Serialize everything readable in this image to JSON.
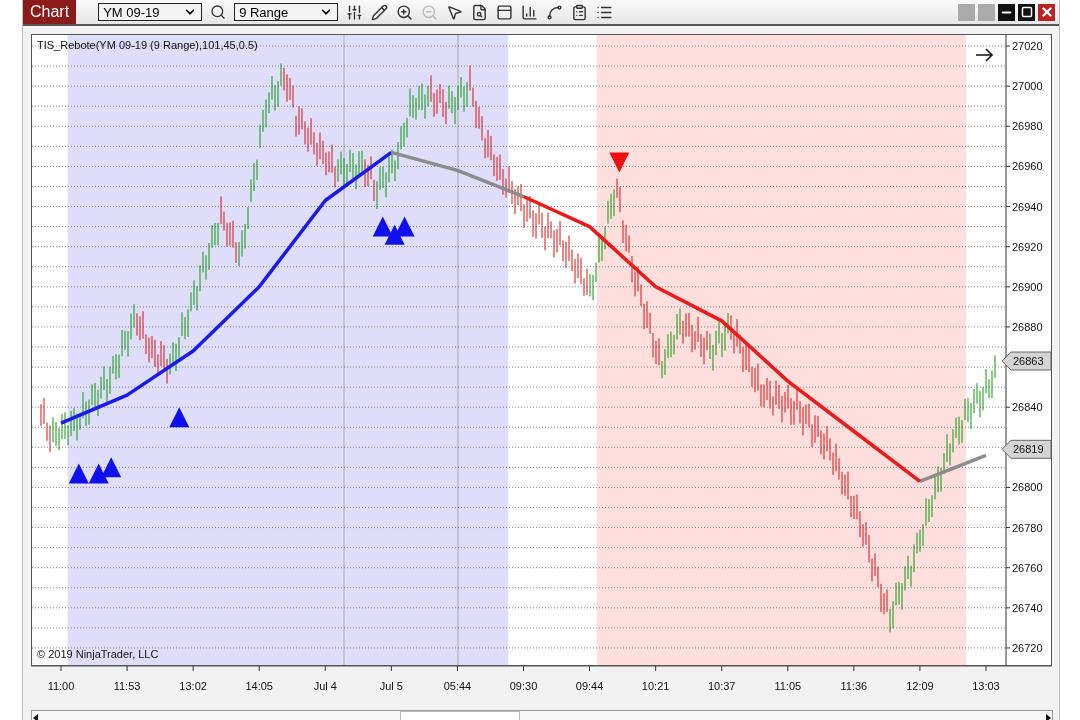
{
  "window": {
    "tab": "Chart",
    "instrument": "YM 09-19",
    "interval": "9 Range"
  },
  "chart": {
    "label": "TIS_Rebote(YM 09-19 (9 Range),101,45,0.5)",
    "copyright": "© 2019 NinjaTrader, LLC",
    "chart_data": {
      "type": "line",
      "categories": [
        "11:00",
        "11:53",
        "13:02",
        "14:05",
        "Jul 4",
        "Jul 5",
        "05:44",
        "09:30",
        "09:44",
        "10:21",
        "10:37",
        "11:05",
        "11:36",
        "12:09",
        "13:03"
      ],
      "ylim": [
        26711,
        27026
      ],
      "yticks": [
        26720,
        26740,
        26760,
        26780,
        26800,
        26840,
        26880,
        26900,
        26920,
        26940,
        26960,
        26980,
        27000,
        27020
      ],
      "grid": true,
      "series": [
        {
          "color": "#1a1aee",
          "values": [
            26832,
            26846,
            26868,
            26900,
            26943,
            26967,
            null,
            null,
            null,
            null,
            null,
            null,
            null,
            null,
            null
          ]
        },
        {
          "color": "#8c8c8c",
          "values": [
            null,
            null,
            null,
            null,
            null,
            26967,
            26958,
            26945,
            null,
            null,
            null,
            null,
            null,
            26803,
            26816
          ]
        },
        {
          "color": "#ee1a1a",
          "values": [
            null,
            null,
            null,
            null,
            null,
            null,
            null,
            26945,
            26930,
            26900,
            26883,
            26853,
            26828,
            26803,
            null
          ]
        }
      ],
      "annotations": [
        "26863",
        "26819"
      ]
    }
  }
}
